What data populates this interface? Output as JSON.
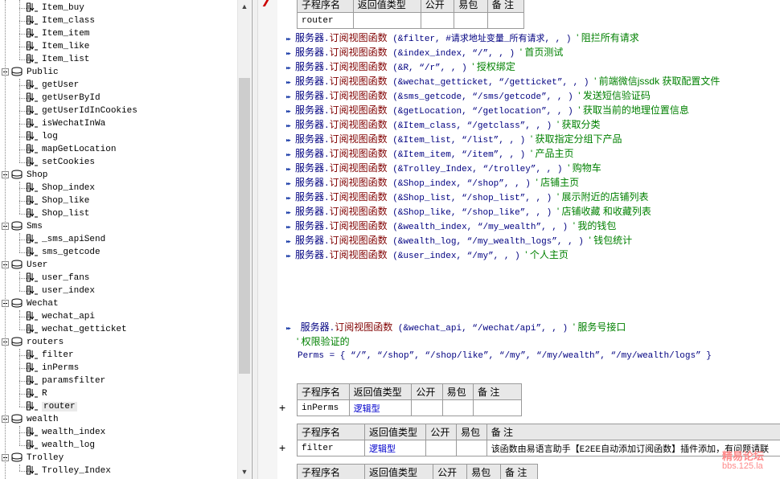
{
  "tree": {
    "groups": [
      {
        "label": "Public",
        "children": [
          "getUser",
          "getUserById",
          "getUserIdInCookies",
          "isWechatInWa",
          "log",
          "mapGetLocation",
          "setCookies"
        ]
      },
      {
        "label": "Shop",
        "children": [
          "Shop_index",
          "Shop_like",
          "Shop_list"
        ]
      },
      {
        "label": "Sms",
        "children": [
          "_sms_apiSend",
          "sms_getcode"
        ]
      },
      {
        "label": "User",
        "children": [
          "user_fans",
          "user_index"
        ]
      },
      {
        "label": "Wechat",
        "children": [
          "wechat_api",
          "wechat_getticket"
        ]
      },
      {
        "label": "routers",
        "children": [
          "filter",
          "inPerms",
          "paramsfilter",
          "R",
          "router"
        ]
      },
      {
        "label": "wealth",
        "children": [
          "wealth_index",
          "wealth_log"
        ]
      },
      {
        "label": "Trolley",
        "children": [
          "Trolley_Index"
        ]
      }
    ],
    "top_items": [
      "Item_buy",
      "Item_class",
      "Item_item",
      "Item_like",
      "Item_list"
    ],
    "selected": "router"
  },
  "code": {
    "obj": "服务器",
    "fn": "订阅视图函数",
    "lines": [
      {
        "args": "(&filter, #请求地址变量_所有请求, , )",
        "comment": "' 阻拦所有请求"
      },
      {
        "args": "(&index_index, “/”, , )",
        "comment": "' 首页测试"
      },
      {
        "args": "(&R, “/r”, , )",
        "comment": "' 授权绑定"
      },
      {
        "args": "(&wechat_getticket, “/getticket”, , )",
        "comment": "' 前端微信jssdk 获取配置文件"
      },
      {
        "args": "(&sms_getcode, “/sms/getcode”, , )",
        "comment": "' 发送短信验证码"
      },
      {
        "args": "(&getLocation, “/getlocation”, , )",
        "comment": "' 获取当前的地理位置信息"
      },
      {
        "args": "(&Item_class, “/getclass”, , )",
        "comment": "' 获取分类"
      },
      {
        "args": "(&Item_list, “/list”, , )",
        "comment": "' 获取指定分组下产品"
      },
      {
        "args": "(&Item_item, “/item”, , )",
        "comment": "' 产品主页"
      },
      {
        "args": "(&Trolley_Index, “/trolley”, , )",
        "comment": "' 购物车"
      },
      {
        "args": "(&Shop_index, “/shop”, , )",
        "comment": "' 店铺主页"
      },
      {
        "args": "(&Shop_list, “/shop_list”, , )",
        "comment": "' 展示附近的店铺列表"
      },
      {
        "args": "(&Shop_like, “/shop_like”, , )",
        "comment": "' 店铺收藏 和收藏列表"
      },
      {
        "args": "(&wealth_index, “/my_wealth”, , )",
        "comment": "' 我的钱包"
      },
      {
        "args": "(&wealth_log, “/my_wealth_logs”, , )",
        "comment": "' 钱包统计"
      },
      {
        "args": "(&user_index, “/my”, , )",
        "comment": "' 个人主页"
      }
    ],
    "wechat_line": {
      "args": "(&wechat_api, “/wechat/api”, , )",
      "comment": "' 服务号接口"
    },
    "perm_comment": "' 权限验证的",
    "perms_line": "Perms = { “/”, “/shop”, “/shop/like”, “/my”, “/my/wealth”, “/my/wealth/logs” }"
  },
  "table_headers": [
    "子程序名",
    "返回值类型",
    "公开",
    "易包",
    "备 注"
  ],
  "tables": {
    "top": {
      "name": "router",
      "ret": "",
      "pub": "",
      "pkg": "",
      "note": ""
    },
    "inperms": {
      "name": "inPerms",
      "ret": "逻辑型",
      "pub": "",
      "pkg": "",
      "note": ""
    },
    "filter": {
      "name": "filter",
      "ret": "逻辑型",
      "pub": "",
      "pkg": "",
      "note": "该函数由易语言助手【E2EE自动添加订阅函数】插件添加，有问题请联"
    }
  },
  "plus_sign": "+",
  "watermark": {
    "line1": "精易论坛",
    "line2": "bbs.125.la"
  },
  "colors": {
    "fn": "#800000",
    "obj": "#000080",
    "comment": "#008000",
    "bool": "#0000cc"
  }
}
